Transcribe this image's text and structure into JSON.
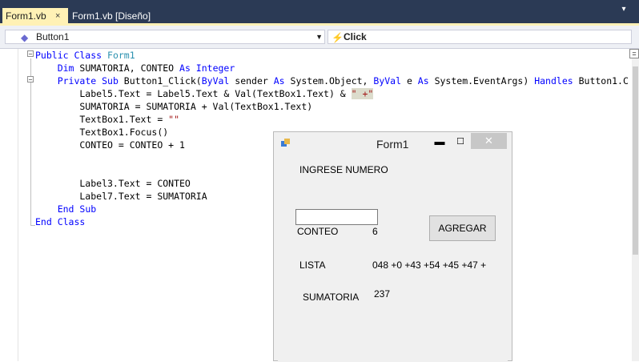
{
  "tabs": [
    {
      "label": "Form1.vb",
      "close": "×"
    },
    {
      "label": "Form1.vb [Diseño]"
    }
  ],
  "tabbar": {
    "overflow_glyph": "▾"
  },
  "navbar": {
    "object_combo": {
      "icon": "class-member-icon",
      "value": "Button1",
      "arrow": "▼"
    },
    "event_combo": {
      "icon": "lightning-event-icon",
      "value": "Click"
    }
  },
  "editor": {
    "fold_open": "−",
    "splitter_glyph": "="
  },
  "code": [
    [
      {
        "t": "Public Class ",
        "c": "kw"
      },
      {
        "t": "Form1",
        "c": "ty"
      }
    ],
    [
      {
        "t": "    "
      },
      {
        "t": "Dim ",
        "c": "kw"
      },
      {
        "t": "SUMATORIA, CONTEO "
      },
      {
        "t": "As Integer",
        "c": "kw"
      }
    ],
    [
      {
        "t": "    "
      },
      {
        "t": "Private Sub ",
        "c": "kw"
      },
      {
        "t": "Button1_Click("
      },
      {
        "t": "ByVal ",
        "c": "kw"
      },
      {
        "t": "sender "
      },
      {
        "t": "As ",
        "c": "kw"
      },
      {
        "t": "System.Object, "
      },
      {
        "t": "ByVal ",
        "c": "kw"
      },
      {
        "t": "e "
      },
      {
        "t": "As ",
        "c": "kw"
      },
      {
        "t": "System.EventArgs) "
      },
      {
        "t": "Handles ",
        "c": "kw"
      },
      {
        "t": "Button1.C"
      }
    ],
    [
      {
        "t": "        Label5.Text = Label5.Text & Val(TextBox1.Text) & "
      },
      {
        "t": "\" +\"",
        "c": "strhl"
      }
    ],
    [
      {
        "t": "        SUMATORIA = SUMATORIA + Val(TextBox1.Text)"
      }
    ],
    [
      {
        "t": "        TextBox1.Text = "
      },
      {
        "t": "\"\"",
        "c": "str"
      }
    ],
    [
      {
        "t": "        TextBox1.Focus()"
      }
    ],
    [
      {
        "t": "        CONTEO = CONTEO + 1"
      }
    ],
    [
      {
        "t": ""
      }
    ],
    [
      {
        "t": ""
      }
    ],
    [
      {
        "t": "        Label3.Text = CONTEO"
      }
    ],
    [
      {
        "t": "        Label7.Text = SUMATORIA"
      }
    ],
    [
      {
        "t": "    "
      },
      {
        "t": "End Sub",
        "c": "kw"
      }
    ],
    [
      {
        "t": "End Class",
        "c": "kw"
      }
    ]
  ],
  "form": {
    "title": "Form1",
    "minimize": "▬",
    "maximize": "☐",
    "close": "✕",
    "prompt_label": "INGRESE NUMERO",
    "textbox_value": "",
    "button_label": "AGREGAR",
    "conteo_label": "CONTEO",
    "conteo_value": "6",
    "lista_label": "LISTA",
    "lista_value": "048 +0 +43 +54 +45 +47 +",
    "sumatoria_label": "SUMATORIA",
    "sumatoria_value": "237"
  }
}
